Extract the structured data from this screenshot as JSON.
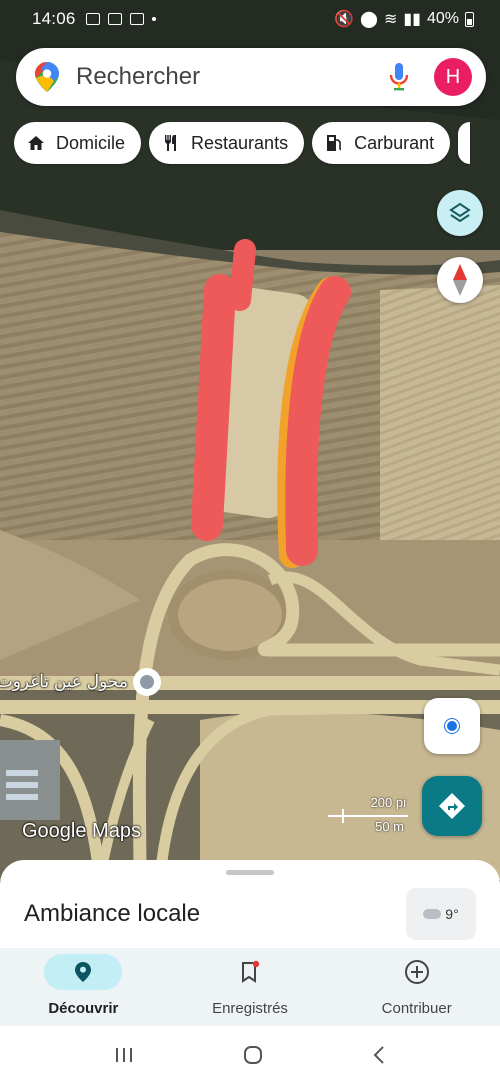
{
  "status_bar": {
    "time": "14:06",
    "battery": "40%"
  },
  "search": {
    "placeholder": "Rechercher",
    "avatar_letter": "H"
  },
  "chips": [
    {
      "label": "Domicile",
      "icon": "home-icon"
    },
    {
      "label": "Restaurants",
      "icon": "fork-knife-icon"
    },
    {
      "label": "Carburant",
      "icon": "fuel-pump-icon"
    }
  ],
  "map": {
    "place_label": "محول عين تاغروت",
    "attribution": "Google Maps",
    "scale_imperial": "200 pi",
    "scale_metric": "50 m",
    "annotation_colors": {
      "red": "#ee5a5a",
      "orange": "#f2a22a"
    }
  },
  "sheet": {
    "title": "Ambiance locale",
    "weather": "9°"
  },
  "bottom_nav": [
    {
      "label": "Découvrir",
      "icon": "explore-pin-icon",
      "active": true
    },
    {
      "label": "Enregistrés",
      "icon": "bookmark-icon",
      "active": false
    },
    {
      "label": "Contribuer",
      "icon": "add-circle-icon",
      "active": false
    }
  ]
}
